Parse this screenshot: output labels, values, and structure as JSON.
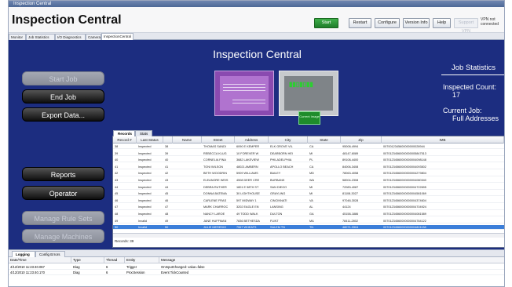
{
  "window": {
    "title": "Inspection Central"
  },
  "header": {
    "app_title": "Inspection Central",
    "buttons": [
      {
        "label": "Start",
        "style": "start"
      },
      {
        "label": "Restart",
        "style": "normal"
      },
      {
        "label": "Configure",
        "style": "normal"
      },
      {
        "label": "Version Info",
        "style": "normal"
      },
      {
        "label": "Help",
        "style": "normal"
      },
      {
        "label": "Support VPN",
        "style": "disabled"
      }
    ],
    "vpn_status": "VPN not connected"
  },
  "tabs": [
    "Monitor",
    "Job Statistics",
    "I/O Diagnostics",
    "Camera",
    "InspectionCentral"
  ],
  "active_tab": "InspectionCentral",
  "main": {
    "title": "Inspection Central",
    "sidebar_buttons": [
      {
        "label": "Start Job",
        "enabled": false
      },
      {
        "label": "End Job",
        "enabled": true
      },
      {
        "label": "Export Data...",
        "enabled": true
      },
      {
        "label": "Reports",
        "enabled": true
      },
      {
        "label": "Operator",
        "enabled": true
      },
      {
        "label": "Manage Rule Sets",
        "enabled": false
      },
      {
        "label": "Manage Machines",
        "enabled": false
      }
    ],
    "thumbnail_label": "Current Image"
  },
  "job_stats": {
    "heading": "Job Statistics",
    "inspected_label": "Inspected Count:",
    "inspected_value": "17",
    "job_label": "Current Job:",
    "job_value": "Full Addresses"
  },
  "grid": {
    "tabs": [
      "Records",
      "Stats"
    ],
    "active_tab": "Records",
    "columns": [
      "Record #",
      "Last Status",
      "",
      "Name",
      "Street",
      "Address",
      "City",
      "State",
      "Zip",
      "IMB"
    ],
    "rows": [
      [
        "38",
        "Inspected",
        "38",
        "",
        "THOMAS SANDI",
        "6090 E KEMPER",
        "ELK GROVE VIL",
        "CA",
        "95008-4994",
        "0070012345600000000028944"
      ],
      [
        "39",
        "Inspected",
        "39",
        "",
        "REBECCA KLUG",
        "10 FOREVER W",
        "DEARBORN HEI",
        "MI",
        "48147-6089",
        "00701234560000000005847513"
      ],
      [
        "40",
        "Inspected",
        "40",
        "",
        "CORNELIA FINA",
        "3682 LAKEVIEW",
        "PHILADELPHIA",
        "PL",
        "89108-4400",
        "00701234560000000004098148"
      ],
      [
        "41",
        "Inspected",
        "41",
        "",
        "TONI WILSON",
        "48021 AMBERN",
        "APOLLO BEACH",
        "CA",
        "84006-3408",
        "00701234560000000004093502"
      ],
      [
        "42",
        "Inspected",
        "42",
        "",
        "BETH WOODRIN",
        "5909 WILLIAMS",
        "BAILEY",
        "MD",
        "78063-4058",
        "00701234560000000004279804"
      ],
      [
        "43",
        "Inspected",
        "43",
        "",
        "ELEANORE WEIS",
        "4508 DEER CRE",
        "BURBANK",
        "WA",
        "58004-2308",
        "00701234560000000004080340"
      ],
      [
        "44",
        "Inspected",
        "44",
        "",
        "DEBRA RUTHER",
        "1801 E 58TH ST",
        "SAN DIEGO",
        "MI",
        "72083-4087",
        "00701234560000000004722695"
      ],
      [
        "45",
        "Inspected",
        "45",
        "",
        "DONNA BATEMA",
        "30 LIGHTHOUSE",
        "GRAYLING",
        "MI",
        "81108-3027",
        "00701234560000000004581069"
      ],
      [
        "46",
        "Inspected",
        "46",
        "",
        "CARLENE FRAS",
        "597 MIDWAY 1",
        "CINCINNATI",
        "VA",
        "97048-3028",
        "00701234560000000004374604"
      ],
      [
        "47",
        "Inspected",
        "47",
        "",
        "MARK CHARROC",
        "3202 EAGLE EN",
        "LANSING",
        "AL",
        "44124",
        "00701234560000000004704924"
      ],
      [
        "48",
        "Inspected",
        "48",
        "",
        "NANCY LAROE",
        "49 TODD WALK",
        "DULTON",
        "GA",
        "45158-1886",
        "00701234560000000004081589"
      ],
      [
        "49",
        "Invalid",
        "49",
        "",
        "JANE HUFFMAN",
        "7836 BETHESDA",
        "FLINT",
        "MA",
        "78411-2802",
        "00701234560000000004784122"
      ],
      [
        "50",
        "Invalid",
        "50",
        "",
        "JULIE MEREDIG",
        "7567 WHEATS",
        "SALEM TN",
        "TN",
        "48071-3304",
        "00701234560000000004801138"
      ]
    ],
    "selected_row": 12,
    "footer": "Records: 39"
  },
  "log": {
    "tabs": [
      "Logging",
      "Config Errors"
    ],
    "active_tab": "Logging",
    "columns": [
      "Date/Time",
      "Type",
      "Thread",
      "Entity",
      "Message"
    ],
    "rows": [
      [
        "4/12/2010 11:23:40.067",
        "Diag",
        "6",
        "Trigger",
        "OnInputChanged: value=false"
      ],
      [
        "4/12/2010 11:23:40.170",
        "Diag",
        "6",
        "ProcSession",
        "Event TickCounted"
      ]
    ]
  }
}
